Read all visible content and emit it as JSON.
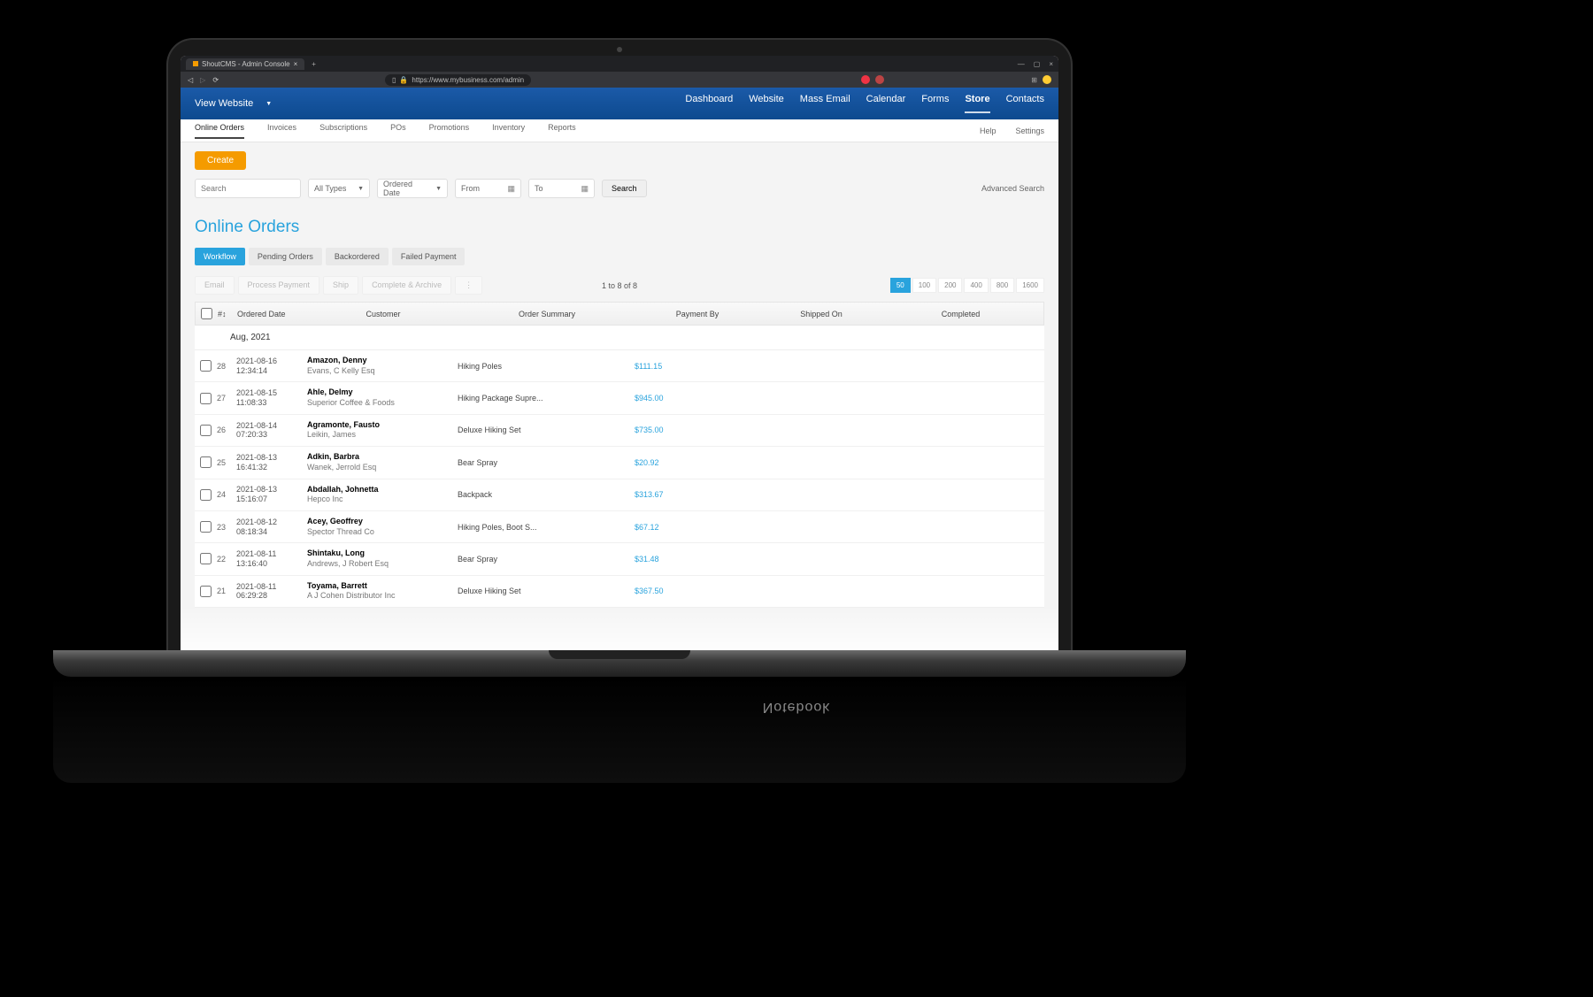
{
  "browser": {
    "tab_title": "ShoutCMS - Admin Console",
    "url": "https://www.mybusiness.com/admin"
  },
  "header": {
    "view_website": "View Website",
    "nav": [
      "Dashboard",
      "Website",
      "Mass Email",
      "Calendar",
      "Forms",
      "Store",
      "Contacts"
    ],
    "active_nav": "Store"
  },
  "subnav": {
    "items": [
      "Online Orders",
      "Invoices",
      "Subscriptions",
      "POs",
      "Promotions",
      "Inventory",
      "Reports"
    ],
    "active": "Online Orders",
    "right": [
      "Help",
      "Settings"
    ]
  },
  "toolbar": {
    "create": "Create",
    "search_placeholder": "Search",
    "all_types": "All Types",
    "ordered_date": "Ordered Date",
    "from": "From",
    "to": "To",
    "search_btn": "Search",
    "advanced": "Advanced Search"
  },
  "page": {
    "title": "Online Orders",
    "tabs": [
      "Workflow",
      "Pending Orders",
      "Backordered",
      "Failed Payment"
    ],
    "active_tab": "Workflow",
    "actions": [
      "Email",
      "Process Payment",
      "Ship",
      "Complete & Archive",
      "⋮"
    ],
    "range_text": "1 to 8 of 8",
    "page_sizes": [
      "50",
      "100",
      "200",
      "400",
      "800",
      "1600"
    ],
    "selected_page_size": "50"
  },
  "table": {
    "headers": {
      "num": "#↕",
      "ordered": "Ordered Date",
      "customer": "Customer",
      "summary": "Order Summary",
      "payment": "Payment By",
      "shipped": "Shipped On",
      "completed": "Completed"
    },
    "group": "Aug, 2021",
    "rows": [
      {
        "num": "28",
        "date": "2021-08-16",
        "time": "12:34:14",
        "name": "Amazon, Denny",
        "sub": "Evans, C Kelly Esq",
        "summary": "Hiking Poles",
        "pay": "$111.15"
      },
      {
        "num": "27",
        "date": "2021-08-15",
        "time": "11:08:33",
        "name": "Ahle, Delmy",
        "sub": "Superior Coffee & Foods",
        "summary": "Hiking Package Supre...",
        "pay": "$945.00"
      },
      {
        "num": "26",
        "date": "2021-08-14",
        "time": "07:20:33",
        "name": "Agramonte, Fausto",
        "sub": "Leikin, James",
        "summary": "Deluxe Hiking Set",
        "pay": "$735.00"
      },
      {
        "num": "25",
        "date": "2021-08-13",
        "time": "16:41:32",
        "name": "Adkin, Barbra",
        "sub": "Wanek, Jerrold Esq",
        "summary": "Bear Spray",
        "pay": "$20.92"
      },
      {
        "num": "24",
        "date": "2021-08-13",
        "time": "15:16:07",
        "name": "Abdallah, Johnetta",
        "sub": "Hepco Inc",
        "summary": "Backpack",
        "pay": "$313.67"
      },
      {
        "num": "23",
        "date": "2021-08-12",
        "time": "08:18:34",
        "name": "Acey, Geoffrey",
        "sub": "Spector Thread Co",
        "summary": "Hiking Poles, Boot S...",
        "pay": "$67.12"
      },
      {
        "num": "22",
        "date": "2021-08-11",
        "time": "13:16:40",
        "name": "Shintaku, Long",
        "sub": "Andrews, J Robert Esq",
        "summary": "Bear Spray",
        "pay": "$31.48"
      },
      {
        "num": "21",
        "date": "2021-08-11",
        "time": "06:29:28",
        "name": "Toyama, Barrett",
        "sub": "A J Cohen Distributor Inc",
        "summary": "Deluxe Hiking Set",
        "pay": "$367.50"
      }
    ]
  },
  "laptop_brand": "Notebook"
}
